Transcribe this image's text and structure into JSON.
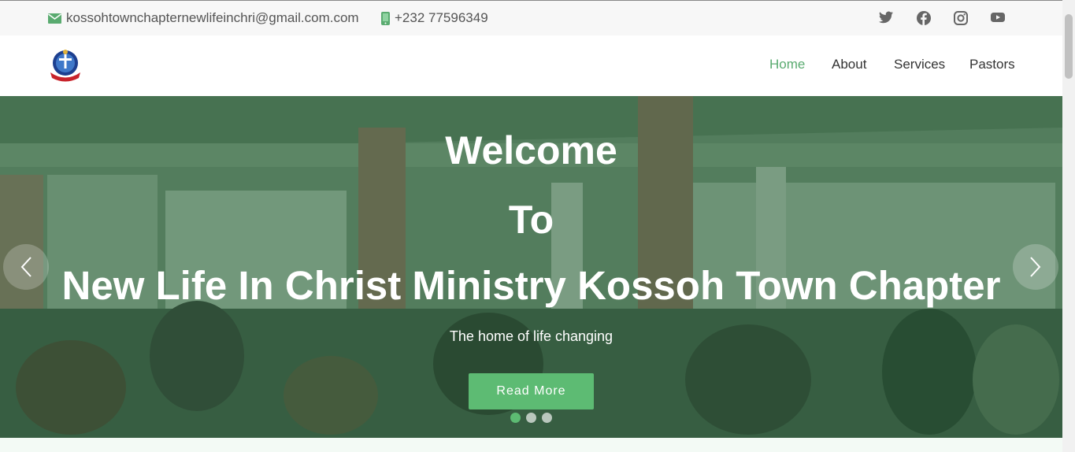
{
  "topbar": {
    "email": "kossohtownchapternewlifeinchri@gmail.com.com",
    "phone": "+232 77596349",
    "social": [
      "twitter-icon",
      "facebook-icon",
      "instagram-icon",
      "youtube-icon"
    ]
  },
  "nav": {
    "items": [
      {
        "label": "Home",
        "active": true
      },
      {
        "label": "About"
      },
      {
        "label": "Services"
      },
      {
        "label": "Pastors"
      }
    ]
  },
  "hero": {
    "line1": "Welcome",
    "line2": "To",
    "line3": "New Life In Christ Ministry Kossoh Town Chapter",
    "subtitle": "The home of life changing",
    "button": "Read More",
    "slides": 3,
    "active_slide": 1
  },
  "colors": {
    "accent": "#5aab70",
    "button": "#5dbb73",
    "overlay": "#265c34"
  }
}
